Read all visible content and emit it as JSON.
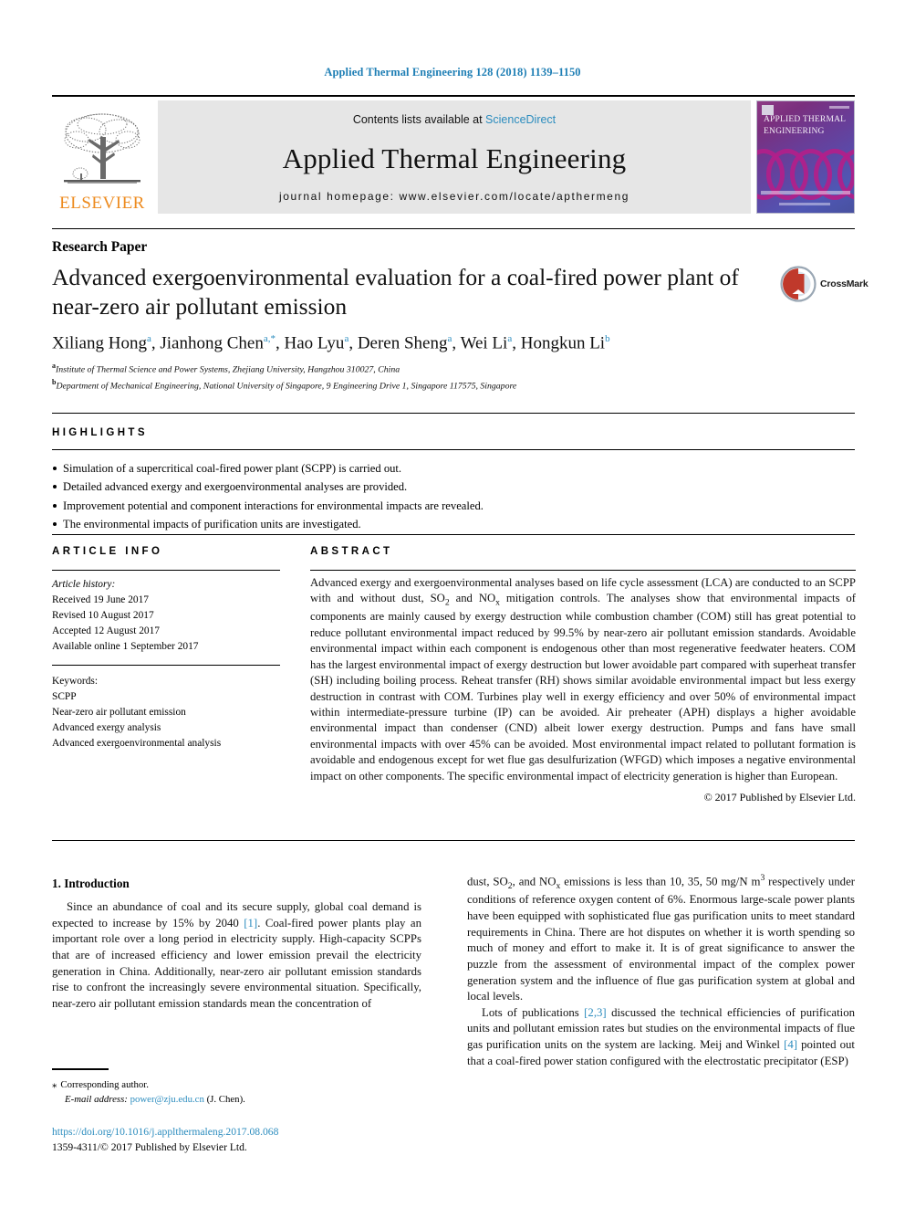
{
  "running_head": "Applied Thermal Engineering 128 (2018) 1139–1150",
  "masthead": {
    "contents_prefix": "Contents lists available at ",
    "sciencedirect": "ScienceDirect",
    "journal_title": "Applied Thermal Engineering",
    "homepage": "journal homepage: www.elsevier.com/locate/apthermeng",
    "publisher_wordmark": "ELSEVIER",
    "cover_title": "Applied Thermal Engineering",
    "accent_blue": "#2b8cbe",
    "elsevier_orange": "#ed8b1f"
  },
  "article": {
    "type": "Research Paper",
    "title": "Advanced exergoenvironmental evaluation for a coal-fired power plant of near-zero air pollutant emission",
    "crossmark_label": "CrossMark",
    "authors": [
      {
        "name": "Xiliang Hong",
        "sup": "a",
        "sep": ", "
      },
      {
        "name": "Jianhong Chen",
        "sup": "a,*",
        "sep": ", "
      },
      {
        "name": "Hao Lyu",
        "sup": "a",
        "sep": ", "
      },
      {
        "name": "Deren Sheng",
        "sup": "a",
        "sep": ", "
      },
      {
        "name": "Wei Li",
        "sup": "a",
        "sep": ", "
      },
      {
        "name": "Hongkun Li",
        "sup": "b",
        "sep": ""
      }
    ],
    "affiliations": [
      {
        "marker": "a",
        "text": "Institute of Thermal Science and Power Systems, Zhejiang University, Hangzhou 310027, China"
      },
      {
        "marker": "b",
        "text": "Department of Mechanical Engineering, National University of Singapore, 9 Engineering Drive 1, Singapore 117575, Singapore"
      }
    ]
  },
  "highlights": {
    "heading": "HIGHLIGHTS",
    "items": [
      "Simulation of a supercritical coal-fired power plant (SCPP) is carried out.",
      "Detailed advanced exergy and exergoenvironmental analyses are provided.",
      "Improvement potential and component interactions for environmental impacts are revealed.",
      "The environmental impacts of purification units are investigated."
    ]
  },
  "article_info": {
    "heading": "ARTICLE INFO",
    "history_label": "Article history:",
    "history": [
      "Received 19 June 2017",
      "Revised 10 August 2017",
      "Accepted 12 August 2017",
      "Available online 1 September 2017"
    ],
    "keywords_label": "Keywords:",
    "keywords": [
      "SCPP",
      "Near-zero air pollutant emission",
      "Advanced exergy analysis",
      "Advanced exergoenvironmental analysis"
    ]
  },
  "abstract": {
    "heading": "ABSTRACT",
    "text": "Advanced exergy and exergoenvironmental analyses based on life cycle assessment (LCA) are conducted to an SCPP with and without dust, SO2 and NOx mitigation controls. The analyses show that environmental impacts of components are mainly caused by exergy destruction while combustion chamber (COM) still has great potential to reduce pollutant environmental impact reduced by 99.5% by near-zero air pollutant emission standards. Avoidable environmental impact within each component is endogenous other than most regenerative feedwater heaters. COM has the largest environmental impact of exergy destruction but lower avoidable part compared with superheat transfer (SH) including boiling process. Reheat transfer (RH) shows similar avoidable environmental impact but less exergy destruction in contrast with COM. Turbines play well in exergy efficiency and over 50% of environmental impact within intermediate-pressure turbine (IP) can be avoided. Air preheater (APH) displays a higher avoidable environmental impact than condenser (CND) albeit lower exergy destruction. Pumps and fans have small environmental impacts with over 45% can be avoided. Most environmental impact related to pollutant formation is avoidable and endogenous except for wet flue gas desulfurization (WFGD) which imposes a negative environmental impact on other components. The specific environmental impact of electricity generation is higher than European.",
    "copyright": "© 2017 Published by Elsevier Ltd."
  },
  "body": {
    "section_heading": "1. Introduction",
    "left_para": "Since an abundance of coal and its secure supply, global coal demand is expected to increase by 15% by 2040 [1]. Coal-fired power plants play an important role over a long period in electricity supply. High-capacity SCPPs that are of increased efficiency and lower emission prevail the electricity generation in China. Additionally, near-zero air pollutant emission standards rise to confront the increasingly severe environmental situation. Specifically, near-zero air pollutant emission standards mean the concentration of",
    "left_ref": "[1]",
    "right_para_1": "dust, SO2, and NOx emissions is less than 10, 35, 50 mg/N m3 respectively under conditions of reference oxygen content of 6%. Enormous large-scale power plants have been equipped with sophisticated flue gas purification units to meet standard requirements in China. There are hot disputes on whether it is worth spending so much of money and effort to make it. It is of great significance to answer the puzzle from the assessment of environmental impact of the complex power generation system and the influence of flue gas purification system at global and local levels.",
    "right_para_2": "Lots of publications [2,3] discussed the technical efficiencies of purification units and pollutant emission rates but studies on the environmental impacts of flue gas purification units on the system are lacking. Meij and Winkel [4] pointed out that a coal-fired power station configured with the electrostatic precipitator (ESP)",
    "right_ref_1": "[2,3]",
    "right_ref_2": "[4]"
  },
  "footer": {
    "corresponding_star": "⁎",
    "corresponding_label": "Corresponding author.",
    "email_label": "E-mail address:",
    "email": "power@zju.edu.cn",
    "email_suffix": "(J. Chen).",
    "doi": "https://doi.org/10.1016/j.applthermaleng.2017.08.068",
    "issn_line": "1359-4311/© 2017 Published by Elsevier Ltd."
  }
}
